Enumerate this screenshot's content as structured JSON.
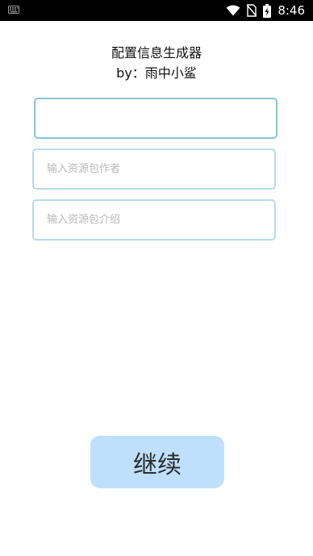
{
  "status_bar": {
    "time": "8:46",
    "icons": [
      "keyboard-icon",
      "wifi-icon",
      "no-sim-icon",
      "battery-charging-icon"
    ]
  },
  "header": {
    "title": "配置信息生成器",
    "subtitle": "by：雨中小鲨"
  },
  "form": {
    "name_field": {
      "value": "",
      "placeholder": ""
    },
    "author_field": {
      "value": "",
      "placeholder": "输入资源包作者"
    },
    "description_field": {
      "value": "",
      "placeholder": "输入资源包介绍"
    }
  },
  "actions": {
    "continue_label": "继续"
  },
  "colors": {
    "status_bar_bg": "#000000",
    "field_border_focused": "#86c6d6",
    "field_border": "#b6dde7",
    "button_bg": "#bfe0fc",
    "background": "#ffffff"
  }
}
